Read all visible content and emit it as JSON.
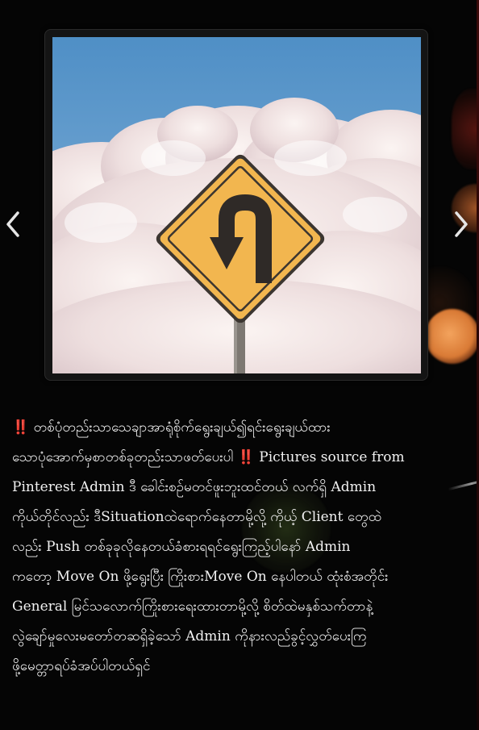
{
  "slider": {
    "image_alt": "U-turn road sign against clouds",
    "prev_icon": "chevron-left-icon",
    "next_icon": "chevron-right-icon"
  },
  "caption": {
    "icon": "double-exclamation-icon",
    "lines": [
      "တစ်ပုံတည်းသာသေချာအာရုံစိုက်ရွေးချယ်၍ရင်းရွေးချယ်ထား",
      "သောပုံအောက်မှစာတစ်ခုတည်းသာဖတ်ပေးပါ",
      "Pictures source from",
      "Pinterest Admin ဒီ ခေါင်းစဉ်မတင်ဖူးဘူးထင်တယ် လက်ရှိ Admin",
      "ကိုယ်တိုင်လည်း ဒီSituationထဲရောက်နေတာမို့လို့ ကိုယ့် Client တွေထဲ",
      "လည်း Push တစ်ခုခုလိုနေတယ်ခံစားရရင်ရွေးကြည့်ပါနော် Admin",
      "ကတော့ Move On ဖို့ရွေးပြီး ကြိုးစားMove On နေပါတယ် ထုံးစံအတိုင်း",
      "General မြင်သလောက်ကြိုးစားရေးထားတာမို့လို့ စိတ်ထဲမနှစ်သက်တာနဲ့",
      "လွဲချော်မှုလေးမတော်တဆရှိခဲ့သော် Admin ကိုနားလည်ခွင့်လွှတ်ပေးကြ",
      "ဖို့မေတ္တာရပ်ခံအပ်ပါတယ်ရှင်"
    ]
  },
  "colors": {
    "background": "#050505",
    "text": "#f2f2f2",
    "mark": "#e0303a",
    "sign_yellow": "#f2b64f",
    "sky": "#5e9ac9"
  }
}
